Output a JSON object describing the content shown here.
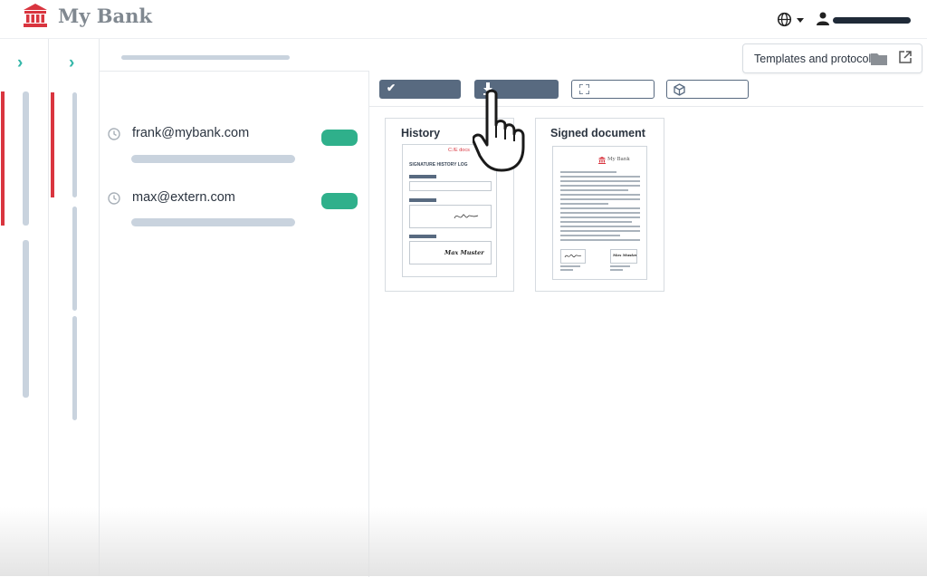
{
  "app": {
    "name": "My Bank"
  },
  "header": {
    "language_icon": "globe-icon",
    "user_icon": "user-icon"
  },
  "toolbar": {
    "templates_label": "Templates and protocol",
    "buttons": [
      "check-icon",
      "download-icon",
      "fullscreen-icon",
      "package-icon"
    ]
  },
  "signers": [
    {
      "email": "frank@mybank.com"
    },
    {
      "email": "max@extern.com"
    }
  ],
  "documents": [
    {
      "title": "History",
      "doc_heading": "SIGNATURE HISTORY LOG",
      "signer_name": "Max Muster",
      "brand": "C:/E docs"
    },
    {
      "title": "Signed document",
      "brand": "My Bank",
      "signer_name": "Max Muster"
    }
  ],
  "colors": {
    "accent": "#35b7a9",
    "status_green": "#2fb08b",
    "brand_red": "#d9353f",
    "button_dark": "#586a80"
  }
}
